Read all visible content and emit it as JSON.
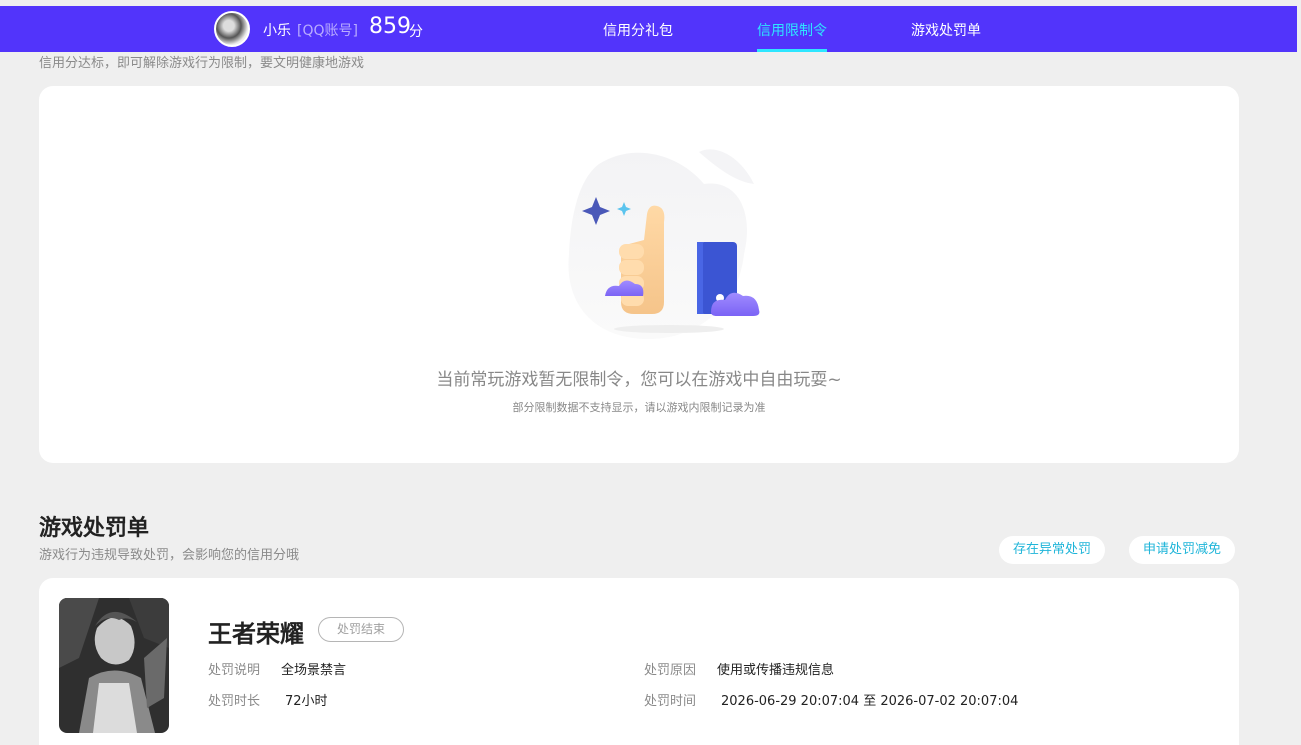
{
  "header": {
    "username": "小乐",
    "account_type": "[QQ账号]",
    "score": "859",
    "score_unit": "分",
    "tabs": [
      {
        "label": "信用分礼包"
      },
      {
        "label": "信用限制令"
      },
      {
        "label": "游戏处罚单"
      }
    ],
    "active_tab": "信用限制令"
  },
  "restriction": {
    "subtitle": "信用分达标，即可解除游戏行为限制，要文明健康地游戏",
    "empty_main": "当前常玩游戏暂无限制令，您可以在游戏中自由玩耍~",
    "empty_sub": "部分限制数据不支持显示，请以游戏内限制记录为准"
  },
  "penalty_section": {
    "title": "游戏处罚单",
    "subtitle": "游戏行为违规导致处罚，会影响您的信用分哦",
    "buttons": {
      "abnormal": "存在异常处罚",
      "appeal": "申请处罚减免"
    }
  },
  "penalty": {
    "game": "王者荣耀",
    "status": "处罚结束",
    "desc_label": "处罚说明",
    "desc_value": "全场景禁言",
    "reason_label": "处罚原因",
    "reason_value": "使用或传播违规信息",
    "duration_label": "处罚时长",
    "duration_value": "72小时",
    "time_label": "处罚时间",
    "time_value": "2026-06-29 20:07:04 至 2026-07-02 20:07:04"
  },
  "colors": {
    "topbar": "#5234fb",
    "active_tab": "#2ee6ff",
    "link": "#1fb5d9",
    "page_bg": "#efefef"
  }
}
